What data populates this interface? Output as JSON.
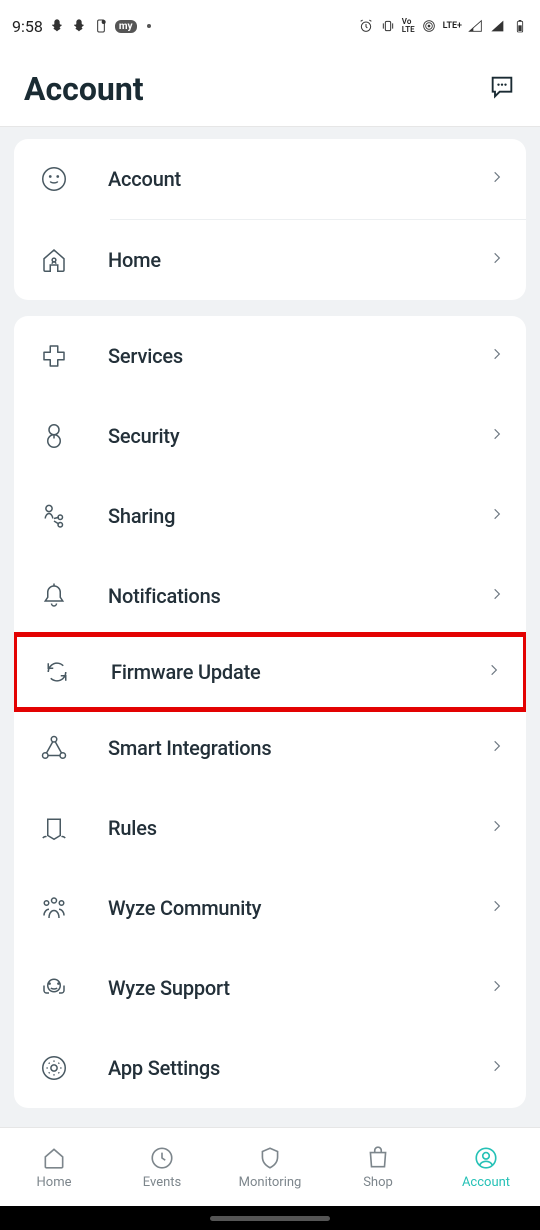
{
  "status_bar": {
    "time": "9:58",
    "network_label": "LTE+",
    "vo_lte": "Vo\nLTE"
  },
  "header": {
    "title": "Account"
  },
  "group1": {
    "items": [
      {
        "label": "Account"
      },
      {
        "label": "Home"
      }
    ]
  },
  "group2": {
    "items": [
      {
        "label": "Services"
      },
      {
        "label": "Security"
      },
      {
        "label": "Sharing"
      },
      {
        "label": "Notifications"
      },
      {
        "label": "Firmware Update",
        "highlighted": true
      },
      {
        "label": "Smart Integrations"
      },
      {
        "label": "Rules"
      },
      {
        "label": "Wyze Community"
      },
      {
        "label": "Wyze Support"
      },
      {
        "label": "App Settings"
      }
    ]
  },
  "bottom_nav": {
    "items": [
      {
        "label": "Home"
      },
      {
        "label": "Events"
      },
      {
        "label": "Monitoring"
      },
      {
        "label": "Shop"
      },
      {
        "label": "Account",
        "active": true
      }
    ]
  }
}
